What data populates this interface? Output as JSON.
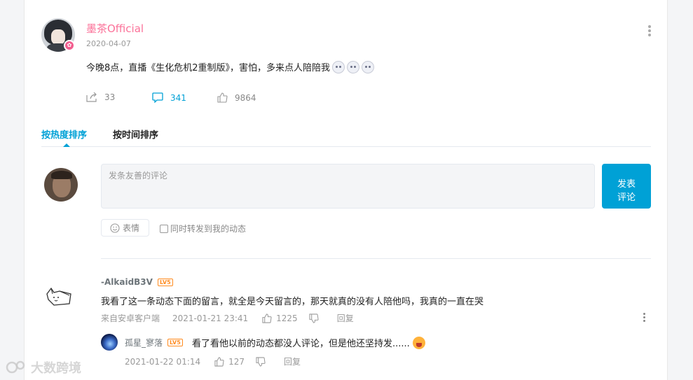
{
  "post": {
    "username": "墨茶Official",
    "date": "2020-04-07",
    "text": "今晚8点，直播《生化危机2重制版》，害怕，多来点人陪陪我",
    "emoji_count": 3,
    "stats": {
      "reposts": "33",
      "comments": "341",
      "likes": "9864"
    }
  },
  "tabs": [
    {
      "label": "按热度排序",
      "active": true
    },
    {
      "label": "按时间排序",
      "active": false
    }
  ],
  "composer": {
    "placeholder": "发条友善的评论",
    "submit_label_line1": "发表",
    "submit_label_line2": "评论",
    "emote_label": "表情",
    "repost_label": "同时转发到我的动态"
  },
  "comments": [
    {
      "username": "-AlkaidB3V",
      "level": "LV5",
      "text": "我看了这一条动态下面的留言，就全是今天留言的，那天就真的没有人陪他吗，我真的一直在哭",
      "source": "来自安卓客户端",
      "time": "2021-01-21 23:41",
      "likes": "1225",
      "reply_label": "回复",
      "replies": [
        {
          "username": "孤星_寥落",
          "level": "LV5",
          "text": "看了看他以前的动态都没人评论，但是他还坚持发......",
          "time": "2021-01-22 01:14",
          "likes": "127",
          "reply_label": "回复"
        }
      ]
    }
  ],
  "watermark": "大数跨境",
  "colors": {
    "accent": "#00a1d6",
    "username_pink": "#fb7299",
    "level_orange": "#ff8b1f"
  }
}
